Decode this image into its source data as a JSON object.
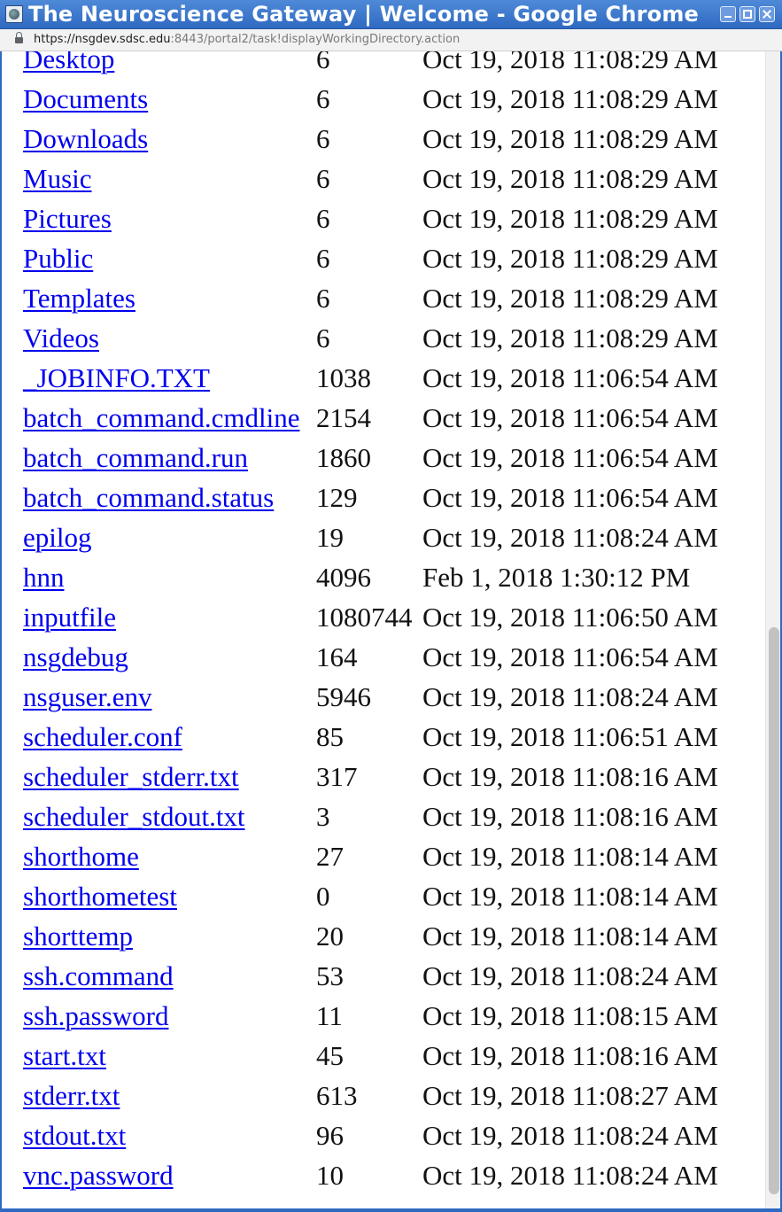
{
  "window": {
    "title": "The Neuroscience Gateway | Welcome - Google Chrome",
    "app_icon": "chrome-app-icon",
    "controls": [
      "minimize-icon",
      "maximize-icon",
      "close-icon"
    ]
  },
  "address_bar": {
    "scheme_host": "https://nsgdev.sdsc.edu",
    "rest": ":8443/portal2/task!displayWorkingDirectory.action",
    "security_icon": "lock-icon"
  },
  "colors": {
    "titlebar": "#2f69c2",
    "link": "#0000ee",
    "text": "#111111"
  },
  "files": [
    {
      "name": "Desktop",
      "size": "6",
      "modified": "Oct 19, 2018 11:08:29 AM"
    },
    {
      "name": "Documents",
      "size": "6",
      "modified": "Oct 19, 2018 11:08:29 AM"
    },
    {
      "name": "Downloads",
      "size": "6",
      "modified": "Oct 19, 2018 11:08:29 AM"
    },
    {
      "name": "Music",
      "size": "6",
      "modified": "Oct 19, 2018 11:08:29 AM"
    },
    {
      "name": "Pictures",
      "size": "6",
      "modified": "Oct 19, 2018 11:08:29 AM"
    },
    {
      "name": "Public",
      "size": "6",
      "modified": "Oct 19, 2018 11:08:29 AM"
    },
    {
      "name": "Templates",
      "size": "6",
      "modified": "Oct 19, 2018 11:08:29 AM"
    },
    {
      "name": "Videos",
      "size": "6",
      "modified": "Oct 19, 2018 11:08:29 AM"
    },
    {
      "name": "_JOBINFO.TXT",
      "size": "1038",
      "modified": "Oct 19, 2018 11:06:54 AM"
    },
    {
      "name": "batch_command.cmdline",
      "size": "2154",
      "modified": "Oct 19, 2018 11:06:54 AM"
    },
    {
      "name": "batch_command.run",
      "size": "1860",
      "modified": "Oct 19, 2018 11:06:54 AM"
    },
    {
      "name": "batch_command.status",
      "size": "129",
      "modified": "Oct 19, 2018 11:06:54 AM"
    },
    {
      "name": "epilog",
      "size": "19",
      "modified": "Oct 19, 2018 11:08:24 AM"
    },
    {
      "name": "hnn",
      "size": "4096",
      "modified": "Feb 1, 2018 1:30:12 PM"
    },
    {
      "name": "inputfile",
      "size": "1080744",
      "modified": "Oct 19, 2018 11:06:50 AM"
    },
    {
      "name": "nsgdebug",
      "size": "164",
      "modified": "Oct 19, 2018 11:06:54 AM"
    },
    {
      "name": "nsguser.env",
      "size": "5946",
      "modified": "Oct 19, 2018 11:08:24 AM"
    },
    {
      "name": "scheduler.conf",
      "size": "85",
      "modified": "Oct 19, 2018 11:06:51 AM"
    },
    {
      "name": "scheduler_stderr.txt",
      "size": "317",
      "modified": "Oct 19, 2018 11:08:16 AM"
    },
    {
      "name": "scheduler_stdout.txt",
      "size": "3",
      "modified": "Oct 19, 2018 11:08:16 AM"
    },
    {
      "name": "shorthome",
      "size": "27",
      "modified": "Oct 19, 2018 11:08:14 AM"
    },
    {
      "name": "shorthometest",
      "size": "0",
      "modified": "Oct 19, 2018 11:08:14 AM"
    },
    {
      "name": "shorttemp",
      "size": "20",
      "modified": "Oct 19, 2018 11:08:14 AM"
    },
    {
      "name": "ssh.command",
      "size": "53",
      "modified": "Oct 19, 2018 11:08:24 AM"
    },
    {
      "name": "ssh.password",
      "size": "11",
      "modified": "Oct 19, 2018 11:08:15 AM"
    },
    {
      "name": "start.txt",
      "size": "45",
      "modified": "Oct 19, 2018 11:08:16 AM"
    },
    {
      "name": "stderr.txt",
      "size": "613",
      "modified": "Oct 19, 2018 11:08:27 AM"
    },
    {
      "name": "stdout.txt",
      "size": "96",
      "modified": "Oct 19, 2018 11:08:24 AM"
    },
    {
      "name": "vnc.password",
      "size": "10",
      "modified": "Oct 19, 2018 11:08:24 AM"
    }
  ]
}
